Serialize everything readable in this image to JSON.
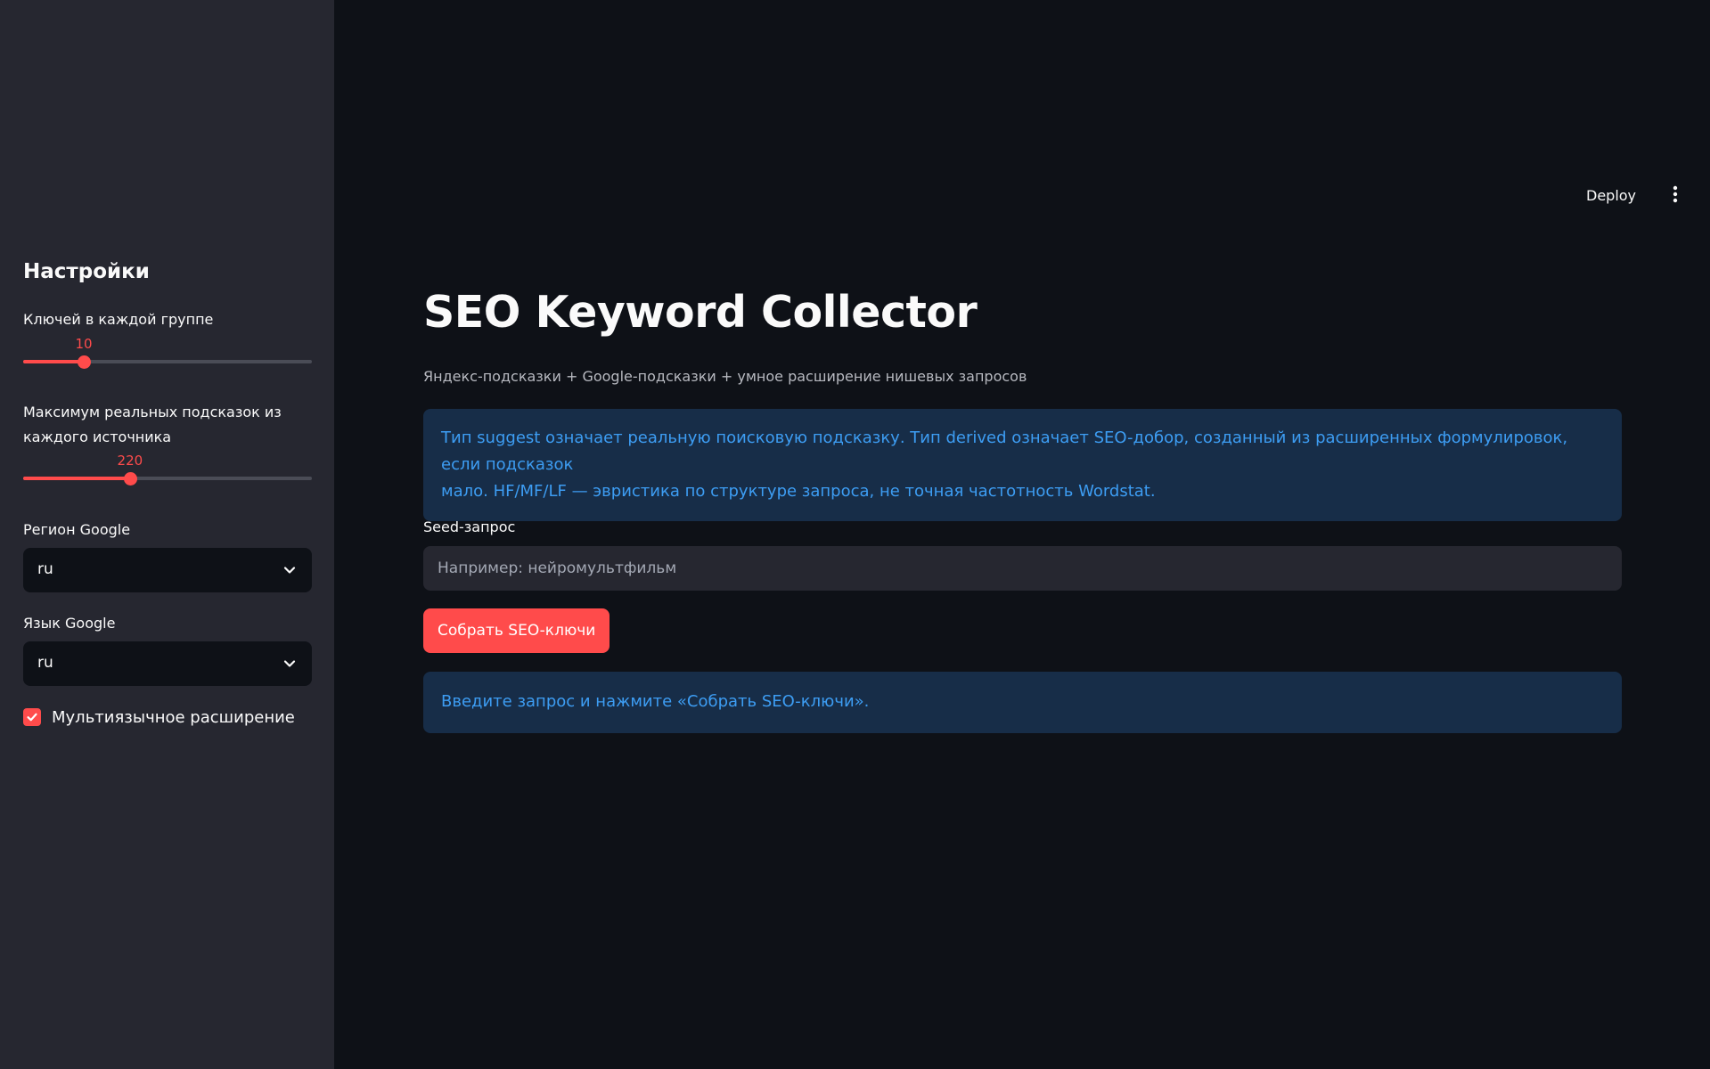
{
  "sidebar": {
    "title": "Настройки",
    "slider_keys": {
      "label": "Ключей в каждой группе",
      "value": "10",
      "fraction": 0.21
    },
    "slider_max": {
      "label_line1": "Максимум реальных подсказок из",
      "label_line2": "каждого источника",
      "value": "220",
      "fraction": 0.37
    },
    "region": {
      "label": "Регион Google",
      "value": "ru"
    },
    "language": {
      "label": "Язык Google",
      "value": "ru"
    },
    "multilang": {
      "label": "Мультиязычное расширение",
      "checked": true
    }
  },
  "header": {
    "deploy_label": "Deploy"
  },
  "main": {
    "title": "SEO Keyword Collector",
    "subtitle": "Яндекс-подсказки + Google-подсказки + умное расширение нишевых запросов",
    "info_line1": "Тип suggest означает реальную поисковую подсказку. Тип derived означает SEO-добор, созданный из расширенных формулировок, если подсказок",
    "info_line2": "мало. HF/MF/LF — эвристика по структуре запроса, не точная частотность Wordstat.",
    "seed_label": "Seed-запрос",
    "seed_placeholder": "Например: нейромультфильм",
    "submit_label": "Собрать SEO-ключи",
    "hint": "Введите запрос и нажмите «Собрать SEO-ключи»."
  },
  "colors": {
    "accent": "#ff4b4b",
    "info_text": "#3d9df3",
    "info_bg": "#172d48",
    "sidebar_bg": "#262730",
    "page_bg": "#0e1117"
  }
}
